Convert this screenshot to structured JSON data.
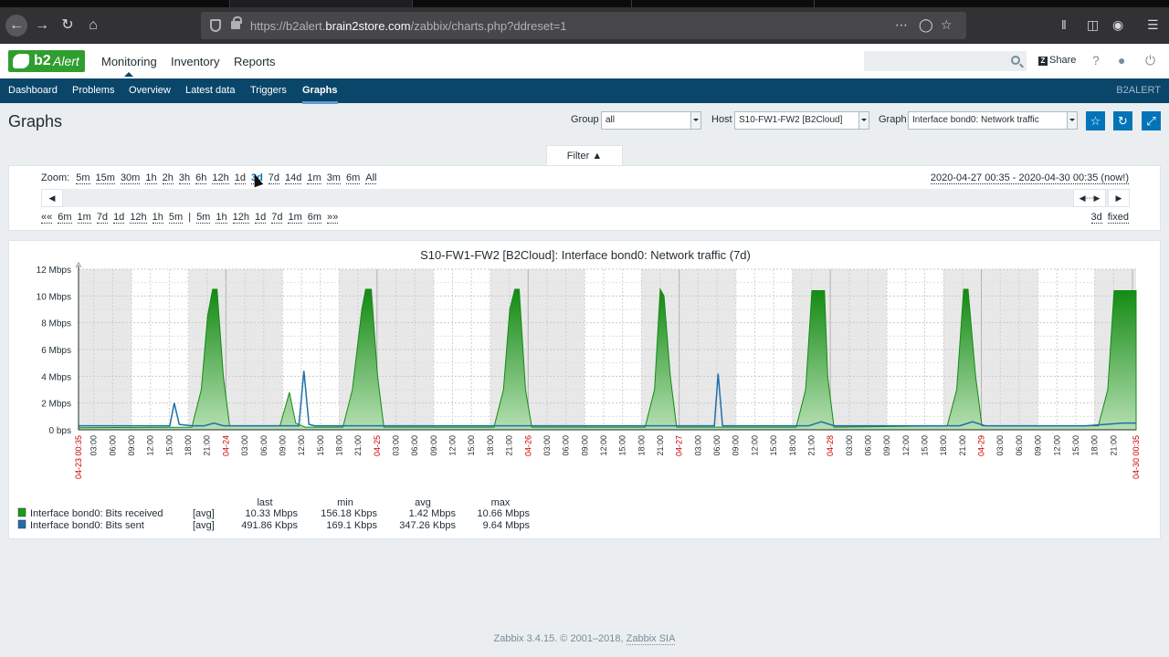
{
  "browser": {
    "url_prefix": "https://b2alert.",
    "url_domain": "brain2store.com",
    "url_path": "/zabbix/charts.php?ddreset=1"
  },
  "header": {
    "logo_b2": "b2",
    "logo_alert": "Alert",
    "menu": [
      "Monitoring",
      "Inventory",
      "Reports"
    ],
    "share_label": "Share",
    "help_label": "?"
  },
  "subnav": {
    "items": [
      "Dashboard",
      "Problems",
      "Overview",
      "Latest data",
      "Triggers",
      "Graphs"
    ],
    "active": "Graphs",
    "brand": "B2ALERT"
  },
  "page": {
    "title": "Graphs",
    "group_label": "Group",
    "group_value": "all",
    "host_label": "Host",
    "host_value": "S10-FW1-FW2 [B2Cloud]",
    "graph_label": "Graph",
    "graph_value": "Interface bond0: Network traffic"
  },
  "filter": {
    "tab_label": "Filter",
    "zoom_label": "Zoom:",
    "zoom_options": [
      "5m",
      "15m",
      "30m",
      "1h",
      "2h",
      "3h",
      "6h",
      "12h",
      "1d",
      "3d",
      "7d",
      "14d",
      "1m",
      "3m",
      "6m",
      "All"
    ],
    "zoom_selected": "3d",
    "period_range": "2020-04-27 00:35 - 2020-04-30 00:35 (now!)",
    "nav_back": [
      "«",
      "6m",
      "1m",
      "7d",
      "1d",
      "12h",
      "1h",
      "5m"
    ],
    "nav_sep": "|",
    "nav_fwd": [
      "5m",
      "1h",
      "12h",
      "1d",
      "7d",
      "1m",
      "6m",
      "»»"
    ],
    "period_value": "3d",
    "period_mode": "fixed"
  },
  "graph": {
    "title": "S10-FW1-FW2 [B2Cloud]: Interface bond0: Network traffic (7d)",
    "legend_headers": [
      "last",
      "min",
      "avg",
      "max"
    ],
    "legend": [
      {
        "name": "Interface bond0: Bits received",
        "func": "[avg]",
        "last": "10.33 Mbps",
        "min": "156.18 Kbps",
        "avg": "1.42 Mbps",
        "max": "10.66 Mbps",
        "color": "#1a9c1a"
      },
      {
        "name": "Interface bond0: Bits sent",
        "func": "[avg]",
        "last": "491.86 Kbps",
        "min": "169.1 Kbps",
        "avg": "347.26 Kbps",
        "max": "9.64 Mbps",
        "color": "#1f6fa8"
      }
    ]
  },
  "chart_data": {
    "type": "area",
    "title": "S10-FW1-FW2 [B2Cloud]: Interface bond0: Network traffic (7d)",
    "ylim": [
      0,
      12
    ],
    "y_ticks": [
      "0 bps",
      "2 Mbps",
      "4 Mbps",
      "6 Mbps",
      "8 Mbps",
      "10 Mbps",
      "12 Mbps"
    ],
    "x_start": "04-23 00:35",
    "x_end": "04-30 00:35",
    "x_ticks": [
      "04-23 00:35",
      "03:00",
      "06:00",
      "09:00",
      "12:00",
      "15:00",
      "18:00",
      "21:00",
      "04-24",
      "03:00",
      "06:00",
      "09:00",
      "12:00",
      "15:00",
      "18:00",
      "21:00",
      "04-25",
      "03:00",
      "06:00",
      "09:00",
      "12:00",
      "15:00",
      "18:00",
      "21:00",
      "04-26",
      "03:00",
      "06:00",
      "09:00",
      "12:00",
      "15:00",
      "18:00",
      "21:00",
      "04-27",
      "03:00",
      "06:00",
      "09:00",
      "12:00",
      "15:00",
      "18:00",
      "21:00",
      "04-28",
      "03:00",
      "06:00",
      "09:00",
      "12:00",
      "15:00",
      "18:00",
      "21:00",
      "04-29",
      "03:00",
      "06:00",
      "09:00",
      "12:00",
      "15:00",
      "18:00",
      "21:00",
      "04-30 00:35"
    ],
    "series": [
      {
        "name": "Interface bond0: Bits received",
        "color": "#1a9c1a",
        "x_hours": [
          0,
          18,
          19.5,
          20.5,
          21.3,
          22,
          23,
          24,
          32,
          33.5,
          34.5,
          36,
          42,
          43.5,
          45,
          45.6,
          46.5,
          47.5,
          48.5,
          66,
          67.5,
          68.5,
          69.3,
          70,
          71,
          72,
          90,
          91.5,
          92.4,
          93,
          94,
          95,
          114,
          115.5,
          116.5,
          117,
          118.5,
          119,
          120,
          138,
          139.5,
          140.6,
          141.3,
          142.5,
          143.5,
          162,
          163.5,
          164.5,
          165.5,
          166.7,
          167.4,
          168
        ],
        "values": [
          0.15,
          0.2,
          3.0,
          8.5,
          10.5,
          10.5,
          4.0,
          0.3,
          0.3,
          2.8,
          0.5,
          0.2,
          0.2,
          3.0,
          9.0,
          10.5,
          10.5,
          4.0,
          0.2,
          0.2,
          3.0,
          9.0,
          10.5,
          10.5,
          3.0,
          0.2,
          0.2,
          3.0,
          10.5,
          10.0,
          4.0,
          0.2,
          0.2,
          3.0,
          10.4,
          10.4,
          10.4,
          4.0,
          0.2,
          0.3,
          3.0,
          10.5,
          10.5,
          4.0,
          0.3,
          0.3,
          3.0,
          10.4,
          10.4,
          10.4,
          10.4,
          10.4
        ]
      },
      {
        "name": "Interface bond0: Bits sent",
        "color": "#1f6fa8",
        "x_hours": [
          0,
          12,
          14.5,
          15.2,
          16,
          18,
          20,
          21.5,
          23,
          35,
          35.8,
          36.6,
          37.5,
          48,
          70,
          72,
          94,
          100,
          101,
          101.6,
          102.3,
          104,
          116,
          118,
          120,
          140,
          142,
          144,
          160,
          166,
          168
        ],
        "values": [
          0.3,
          0.3,
          0.3,
          2.0,
          0.4,
          0.3,
          0.3,
          0.5,
          0.3,
          0.3,
          4.4,
          0.4,
          0.3,
          0.3,
          0.3,
          0.3,
          0.3,
          0.3,
          0.3,
          4.2,
          0.3,
          0.3,
          0.3,
          0.6,
          0.3,
          0.3,
          0.6,
          0.3,
          0.3,
          0.5,
          0.5
        ]
      }
    ],
    "grid": true
  }
}
